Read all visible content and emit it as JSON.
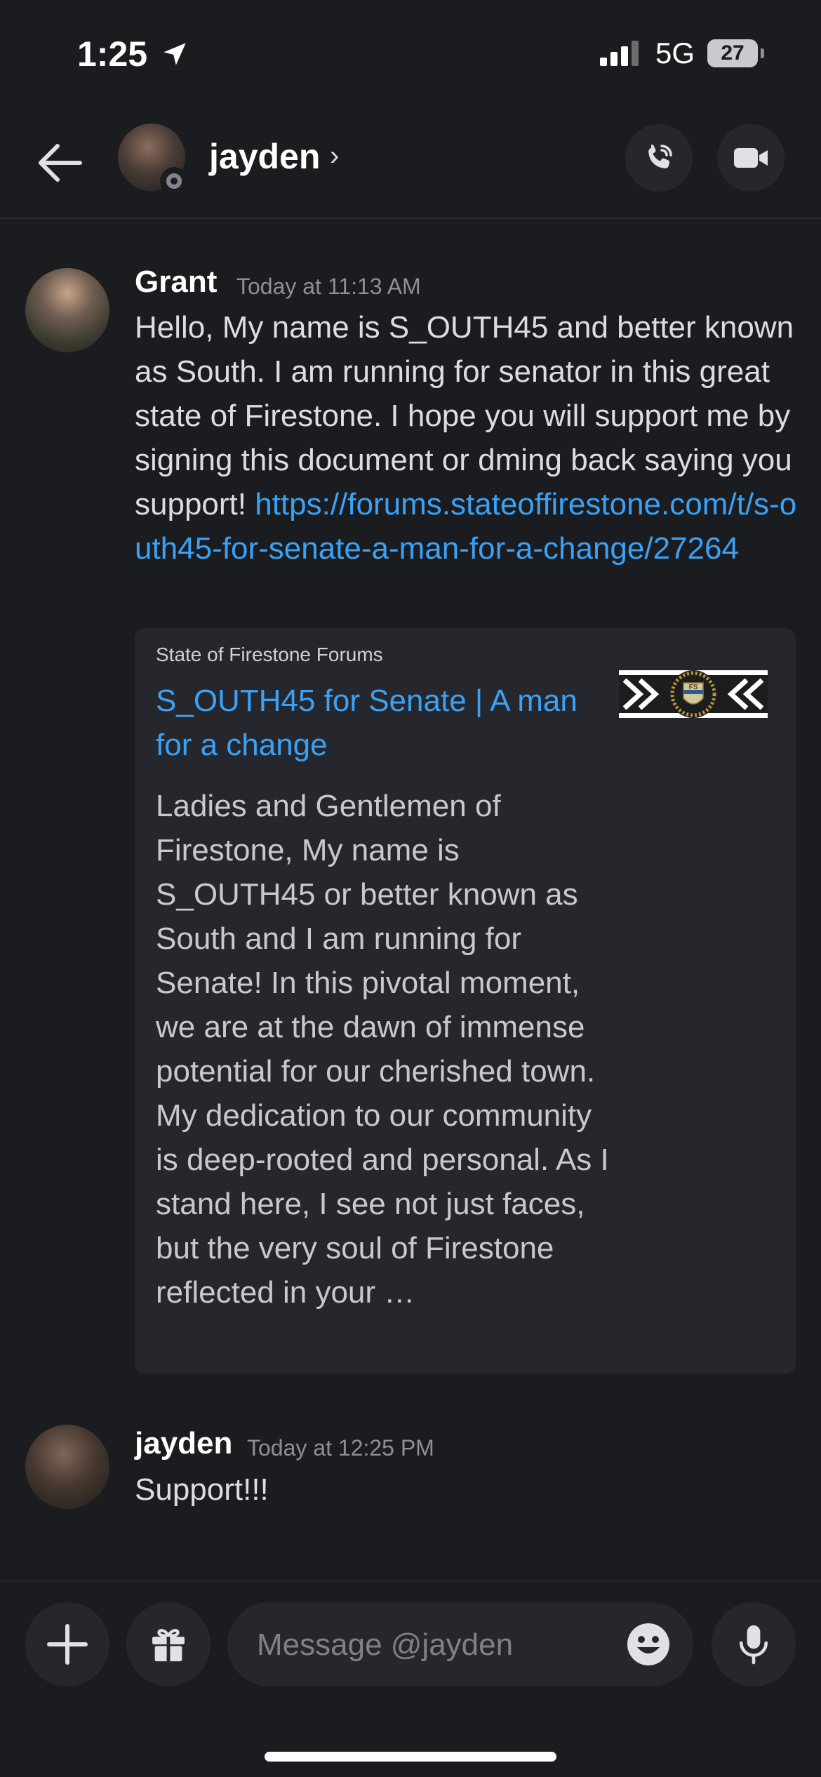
{
  "status_bar": {
    "time": "1:25",
    "network": "5G",
    "battery": "27",
    "icons": [
      "location-arrow-icon",
      "signal-bars-icon",
      "battery-icon"
    ]
  },
  "header": {
    "name": "jayden",
    "chevron": "›",
    "status": "offline",
    "icons": [
      "back-arrow-icon",
      "phone-call-icon",
      "video-camera-icon"
    ]
  },
  "messages": [
    {
      "author": "Grant",
      "timestamp": "Today at 11:13 AM",
      "text": "Hello, My name is S_OUTH45 and better known as South. I am running for senator in this great state of Firestone. I hope you will support me by signing this document or dming back saying you support! ",
      "link": "https://forums.stateoffirestone.com/t/s-outh45-for-senate-a-man-for-a-change/27264",
      "embed": {
        "provider": "State of Firestone Forums",
        "title": "S_OUTH45 for Senate | A man for a change",
        "description": "Ladies and Gentlemen of Firestone,  My name is S_OUTH45 or better known as South and I am running for Senate!  In this pivotal moment, we are at the dawn of immense potential for our cherished town. My dedication to our community is deep-rooted and personal. As I stand here, I see not just faces, but the very soul of Firestone reflected in your …",
        "thumbnail_text": "FS"
      }
    },
    {
      "author": "jayden",
      "timestamp": "Today at 12:25 PM",
      "text": "Support!!!"
    }
  ],
  "composer": {
    "placeholder": "Message @jayden",
    "icons": [
      "plus-icon",
      "gift-icon",
      "emoji-icon",
      "microphone-icon"
    ]
  },
  "colors": {
    "background": "#1b1c20",
    "surface": "#26272c",
    "link": "#3aa1f5",
    "muted_text": "#8e9097"
  }
}
